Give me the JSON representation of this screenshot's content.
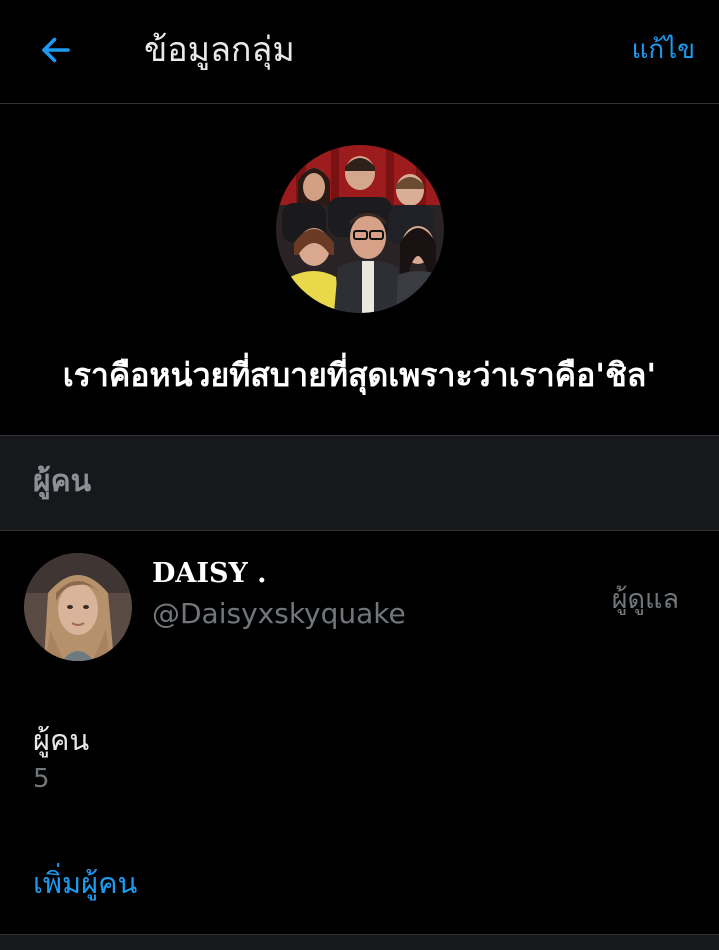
{
  "header": {
    "back_icon": "arrow-left-icon",
    "title": "ข้อมูลกลุ่ม",
    "edit_label": "แก้ไข"
  },
  "group": {
    "avatar": "group-photo",
    "name": "เราคือหน่วยที่สบายที่สุดเพราะว่าเราคือ'ชิล'"
  },
  "people_section": {
    "title": "ผู้คน"
  },
  "members": [
    {
      "avatar": "user-photo",
      "name": "DAISY .",
      "handle": "@Daisyxskyquake",
      "role": "ผู้ดูแล"
    }
  ],
  "people_count": {
    "label": "ผู้คน",
    "value": "5"
  },
  "actions": {
    "add_people_label": "เพิ่มผู้คน"
  },
  "colors": {
    "background": "#000000",
    "accent": "#1d9bf0",
    "section_background": "#16181c",
    "secondary_text": "#71767b",
    "divider": "#2f3336"
  }
}
